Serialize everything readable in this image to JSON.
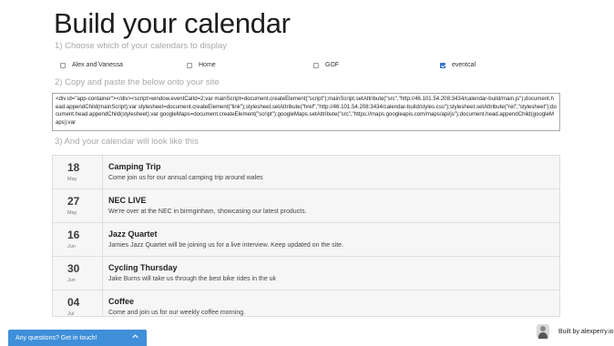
{
  "header": {
    "title": "Build your calendar"
  },
  "steps": {
    "choose": "1) Choose which of your calendars to display",
    "copy": "2) Copy and paste the below onto your site",
    "preview": "3) And your calendar will look like this"
  },
  "calendars": [
    {
      "label": "Alex and Vanessa",
      "checked": false
    },
    {
      "label": "Home",
      "checked": false
    },
    {
      "label": "GOF",
      "checked": false
    },
    {
      "label": "eventcal",
      "checked": true
    }
  ],
  "embed_code": "<div id=\"app-container\"></div><script>window.eventCalId=2;var mainScript=document.createElement(\"script\");mainScript.setAttribute(\"src\",\"http://46.101.54.208:3434/calendar-build/main.js\");document.head.appendChild(mainScript);var stylesheet=document.createElement(\"link\");stylesheet.setAttribute(\"href\",\"http://46.101.54.208:3434/calendar-build/styles.css\");stylesheet.setAttribute(\"rel\",\"stylesheet\");document.head.appendChild(stylesheet);var googleMaps=document.createElement(\"script\");googleMaps.setAttribute(\"src\",\"https://maps.googleapis.com/maps/api/js\");document.head.appendChild(googleMaps);var",
  "events": [
    {
      "day": "18",
      "month": "May",
      "title": "Camping Trip",
      "description": "Come join us for our annual camping trip around wales"
    },
    {
      "day": "27",
      "month": "May",
      "title": "NEC LIVE",
      "description": "We're over at the NEC in birmginham, showcasing our latest products."
    },
    {
      "day": "16",
      "month": "Jun",
      "title": "Jazz Quartet",
      "description": "Jamies Jazz Quartet will be joining us for a live interview. Keep updated on the site."
    },
    {
      "day": "30",
      "month": "Jun",
      "title": "Cycling Thursday",
      "description": "Jake Burns will take us through the best bike rides in the uk"
    },
    {
      "day": "04",
      "month": "Jul",
      "title": "Coffee",
      "description": "Come and join us for our weekly coffee morning."
    }
  ],
  "help": {
    "label": "Any questions? Get in touch!",
    "icon": "chevron-up-icon"
  },
  "credit": {
    "label": "Built by alexperry.io"
  },
  "colors": {
    "accent": "#3f8fd9",
    "checkbox": "#2f6fd6",
    "list_bg": "#f6f6f6"
  }
}
